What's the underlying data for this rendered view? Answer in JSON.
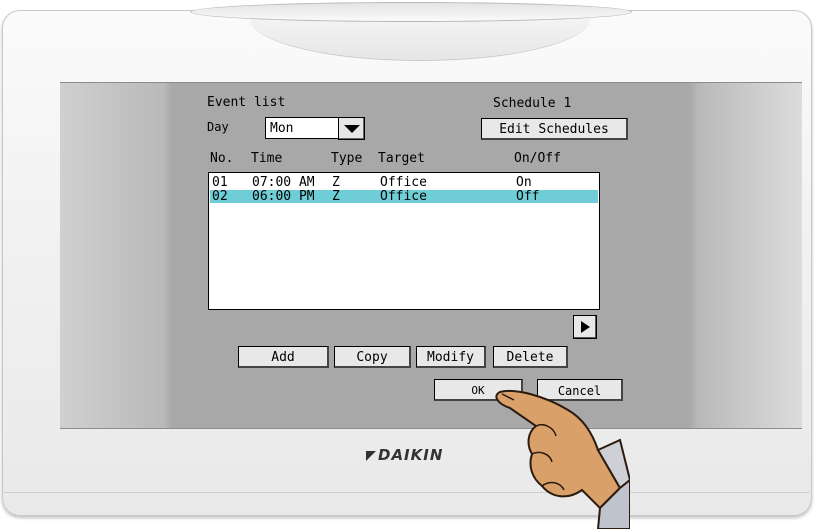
{
  "header": {
    "title": "Event list",
    "schedule_name": "Schedule 1",
    "edit_schedules_label": "Edit Schedules"
  },
  "day": {
    "label": "Day",
    "selected": "Mon"
  },
  "columns": [
    "No.",
    "Time",
    "Type",
    "Target",
    "On/Off"
  ],
  "events": [
    {
      "no": "01",
      "time": "07:00 AM",
      "type": "Z",
      "target": "Office",
      "onoff": "On",
      "selected": false
    },
    {
      "no": "02",
      "time": "06:00 PM",
      "type": "Z",
      "target": "Office",
      "onoff": "Off",
      "selected": true
    }
  ],
  "actions": {
    "add": "Add",
    "copy": "Copy",
    "modify": "Modify",
    "delete": "Delete",
    "ok": "OK",
    "cancel": "Cancel"
  },
  "brand": {
    "logo_text": "DAIKIN"
  },
  "colors": {
    "screen_bg": "#a8a8a8",
    "selected_row": "#6ecdd6",
    "bezel": "#f2f2f2"
  },
  "icons": {
    "dropdown": "triangle-down-icon",
    "scroll": "triangle-right-icon",
    "pointer": "pointing-hand"
  }
}
